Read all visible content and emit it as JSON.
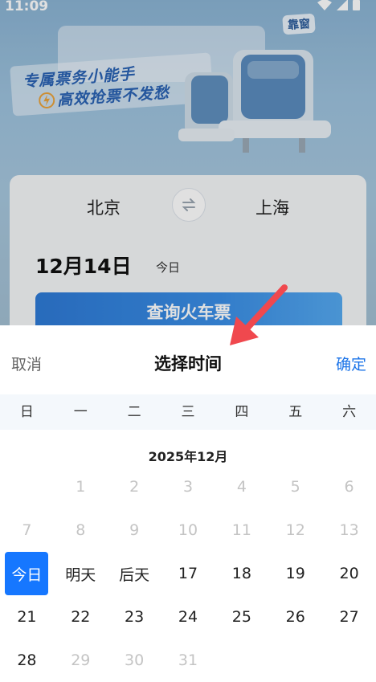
{
  "status_bar": {
    "time": "11:09"
  },
  "banner": {
    "window_tag": "靠窗",
    "slogan_line1": "专属票务小能手",
    "slogan_line2": "高效抢票不发愁"
  },
  "search": {
    "from_city": "北京",
    "to_city": "上海",
    "date": "12月14日",
    "day_label": "今日",
    "search_button": "查询火车票"
  },
  "picker": {
    "cancel": "取消",
    "title": "选择时间",
    "confirm": "确定",
    "weekdays": [
      "日",
      "一",
      "二",
      "三",
      "四",
      "五",
      "六"
    ],
    "month": "2025年12月",
    "weeks": [
      [
        {
          "label": "",
          "state": "empty"
        },
        {
          "label": "1",
          "state": "past"
        },
        {
          "label": "2",
          "state": "past"
        },
        {
          "label": "3",
          "state": "past"
        },
        {
          "label": "4",
          "state": "past"
        },
        {
          "label": "5",
          "state": "past"
        },
        {
          "label": "6",
          "state": "past"
        }
      ],
      [
        {
          "label": "7",
          "state": "past"
        },
        {
          "label": "8",
          "state": "past"
        },
        {
          "label": "9",
          "state": "past"
        },
        {
          "label": "10",
          "state": "past"
        },
        {
          "label": "11",
          "state": "past"
        },
        {
          "label": "12",
          "state": "past"
        },
        {
          "label": "13",
          "state": "past"
        }
      ],
      [
        {
          "label": "今日",
          "state": "today"
        },
        {
          "label": "明天",
          "state": "active"
        },
        {
          "label": "后天",
          "state": "active"
        },
        {
          "label": "17",
          "state": "active"
        },
        {
          "label": "18",
          "state": "active"
        },
        {
          "label": "19",
          "state": "active"
        },
        {
          "label": "20",
          "state": "active"
        }
      ],
      [
        {
          "label": "21",
          "state": "active"
        },
        {
          "label": "22",
          "state": "active"
        },
        {
          "label": "23",
          "state": "active"
        },
        {
          "label": "24",
          "state": "active"
        },
        {
          "label": "25",
          "state": "active"
        },
        {
          "label": "26",
          "state": "active"
        },
        {
          "label": "27",
          "state": "active"
        }
      ],
      [
        {
          "label": "28",
          "state": "active"
        },
        {
          "label": "29",
          "state": "past"
        },
        {
          "label": "30",
          "state": "past"
        },
        {
          "label": "31",
          "state": "past"
        },
        {
          "label": "",
          "state": "empty"
        },
        {
          "label": "",
          "state": "empty"
        },
        {
          "label": "",
          "state": "empty"
        }
      ]
    ]
  },
  "colors": {
    "accent": "#1677ff",
    "confirm_text": "#1a73e8",
    "annotation_arrow": "#f0484e"
  }
}
